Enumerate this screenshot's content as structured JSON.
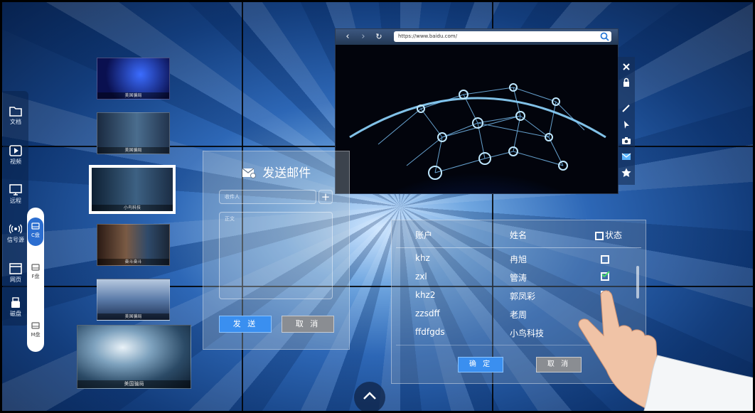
{
  "sidebar": {
    "items": [
      {
        "label": "文档",
        "icon": "folder-icon"
      },
      {
        "label": "视频",
        "icon": "video-icon"
      },
      {
        "label": "远程",
        "icon": "monitor-icon"
      },
      {
        "label": "信号源",
        "icon": "signal-icon"
      },
      {
        "label": "网页",
        "icon": "webpage-icon"
      },
      {
        "label": "磁盘",
        "icon": "usb-disk-icon"
      }
    ],
    "disks": [
      "C盘",
      "F盘",
      "M盘"
    ]
  },
  "thumbnails": [
    {
      "caption": "美国骗局"
    },
    {
      "caption": "美国骗局"
    },
    {
      "caption": "小鸟科技"
    },
    {
      "caption": "奋斗奋斗"
    },
    {
      "caption": "美国骗局"
    },
    {
      "caption": "美国骗局"
    }
  ],
  "browser": {
    "url": "https://www.baidu.com/"
  },
  "mail": {
    "title": "发送邮件",
    "recipient_placeholder": "收件人",
    "body_placeholder": "正文",
    "send_label": "发 送",
    "cancel_label": "取 消",
    "add_symbol": "+"
  },
  "table": {
    "columns": [
      "账户",
      "姓名",
      "状态"
    ],
    "rows": [
      {
        "account": "khz",
        "name": "冉旭",
        "checked": false
      },
      {
        "account": "zxl",
        "name": "管涛",
        "checked": true
      },
      {
        "account": "khz2",
        "name": "郭凤彩",
        "checked": false
      },
      {
        "account": "zzsdff",
        "name": "老周",
        "checked": false
      },
      {
        "account": "ffdfgds",
        "name": "小鸟科技",
        "checked": false
      }
    ],
    "confirm_label": "确 定",
    "cancel_label": "取 消"
  },
  "colors": {
    "accent_blue": "#3a8ff0",
    "panel_button_gray": "#8a8d92"
  }
}
